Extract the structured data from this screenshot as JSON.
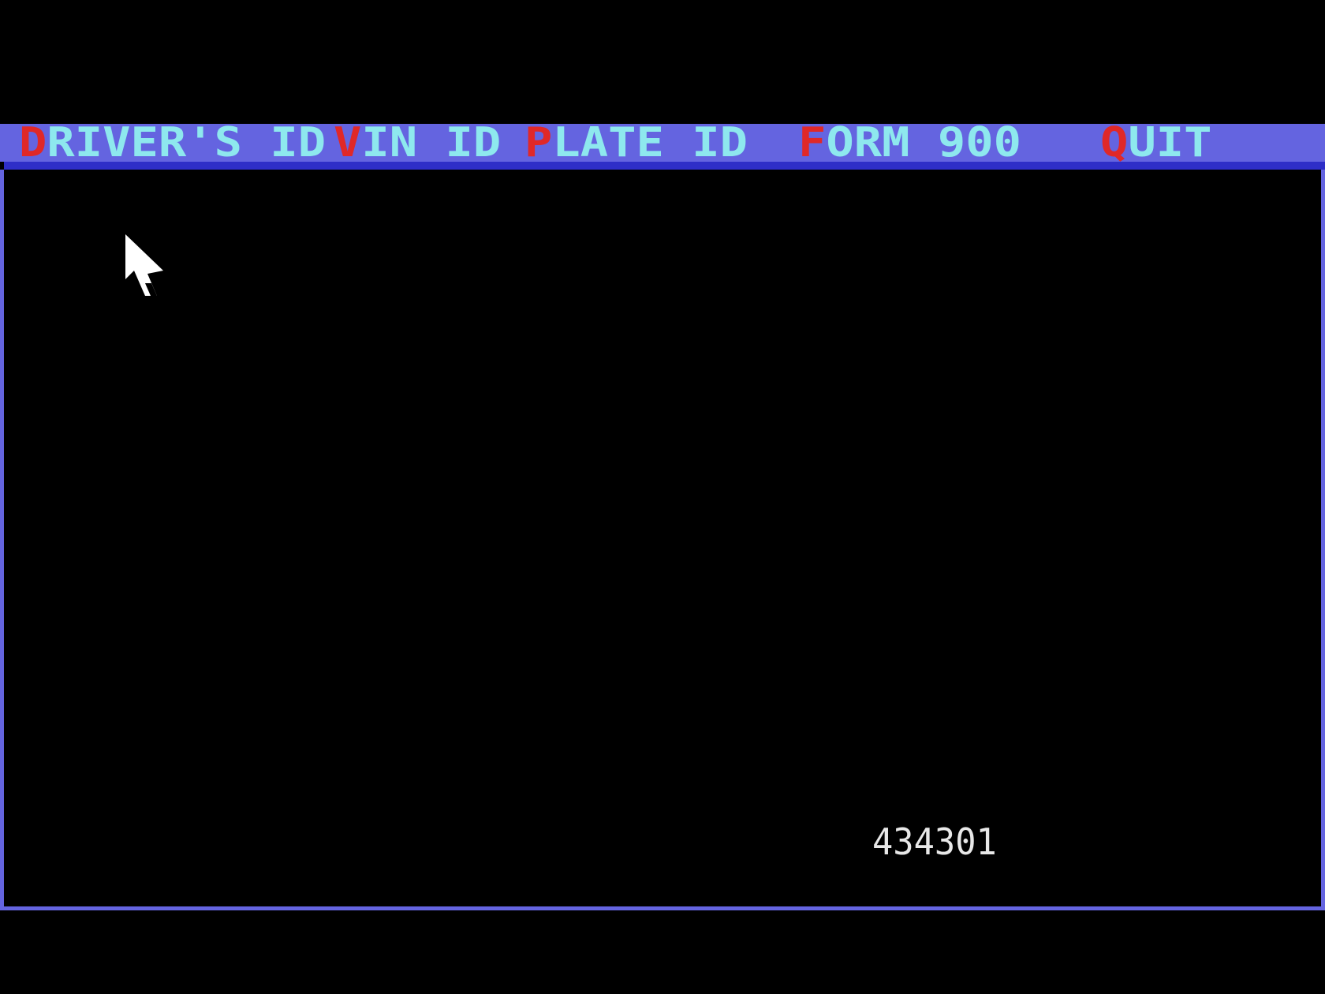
{
  "menu": {
    "items": [
      {
        "hotkey": "D",
        "rest": "RIVER'S ID"
      },
      {
        "hotkey": "V",
        "rest": "IN ID"
      },
      {
        "hotkey": "P",
        "rest": "LATE ID"
      },
      {
        "hotkey": "F",
        "rest": "ORM 900"
      },
      {
        "hotkey": "Q",
        "rest": "UIT"
      }
    ]
  },
  "status": {
    "record_number": "434301"
  },
  "colors": {
    "background": "#000000",
    "menu_bar": "#6464e0",
    "menu_underline": "#2e2ec8",
    "hotkey": "#e02828",
    "menu_text": "#8ee8ee",
    "number_text": "#e8e8e8"
  },
  "cursor": {
    "icon": "arrow-pointer-icon"
  }
}
